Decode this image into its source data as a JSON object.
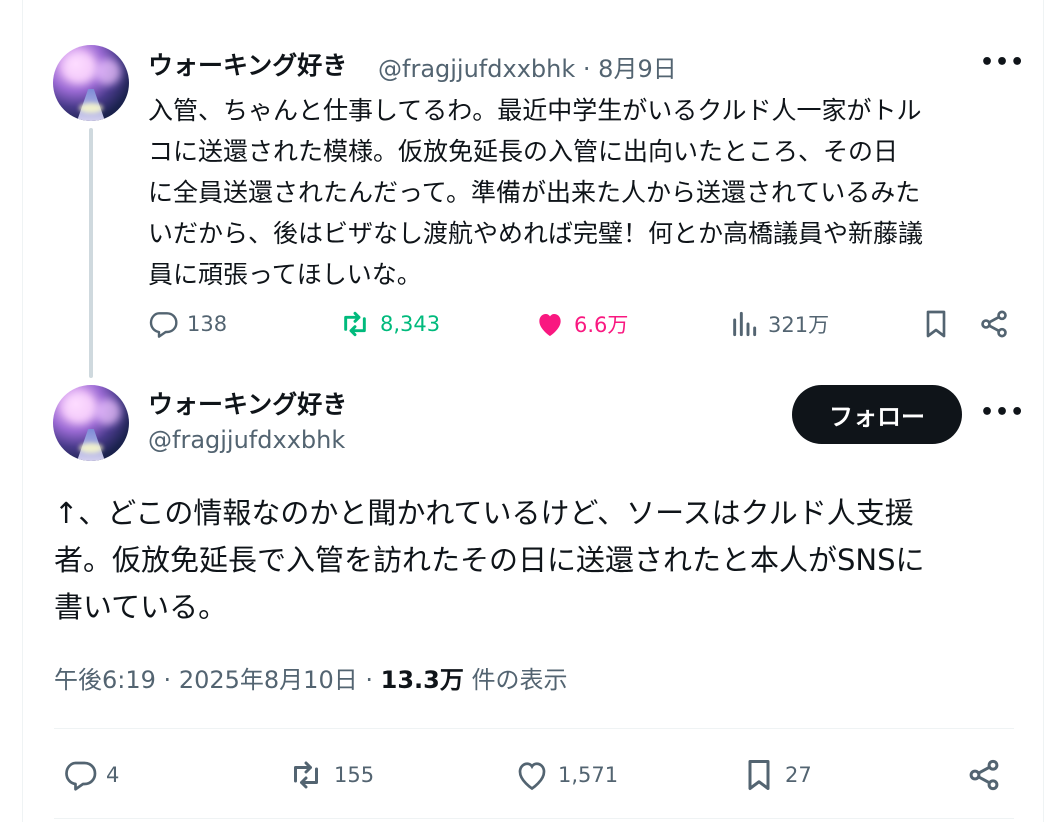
{
  "parent_tweet": {
    "display_name": "ウォーキング好き",
    "handle": "@fragjjufdxxbhk",
    "separator": "·",
    "date": "8月9日",
    "more_label": "•••",
    "lines": [
      "入管、ちゃんと仕事してるわ。最近中学生がいるクルド人一家がトル",
      "コに送還された模様。仮放免延長の入管に出向いたところ、その日",
      "に全員送還されたんだって。準備が出来た人から送還されているみた",
      "いだから、後はビザなし渡航やめれば完璧！何とか高橋議員や新藤議",
      "員に頑張ってほしいな。"
    ],
    "actions": {
      "replies": "138",
      "reposts": "8,343",
      "likes": "6.6万",
      "views": "321万"
    }
  },
  "main_tweet": {
    "display_name": "ウォーキング好き",
    "handle": "@fragjjufdxxbhk",
    "follow_label": "フォロー",
    "more_label": "•••",
    "lines": [
      "↑、どこの情報なのかと聞かれているけど、ソースはクルド人支援",
      "者。仮放免延長で入管を訪れたその日に送還されたと本人がSNSに",
      "書いている。"
    ],
    "time": "午後6:19",
    "dot": "·",
    "date": "2025年8月10日",
    "views_count": "13.3万",
    "views_label": "件の表示",
    "actions": {
      "replies": "4",
      "reposts": "155",
      "likes": "1,571",
      "bookmarks": "27"
    }
  },
  "colors": {
    "text_primary": "#0f1419",
    "text_secondary": "#536471",
    "repost_active": "#00ba7c",
    "like_active": "#f91880",
    "thread_line": "#cfd9de"
  },
  "icons": [
    "reply-icon",
    "repost-icon",
    "like-icon",
    "views-icon",
    "bookmark-icon",
    "share-icon",
    "more-icon"
  ]
}
